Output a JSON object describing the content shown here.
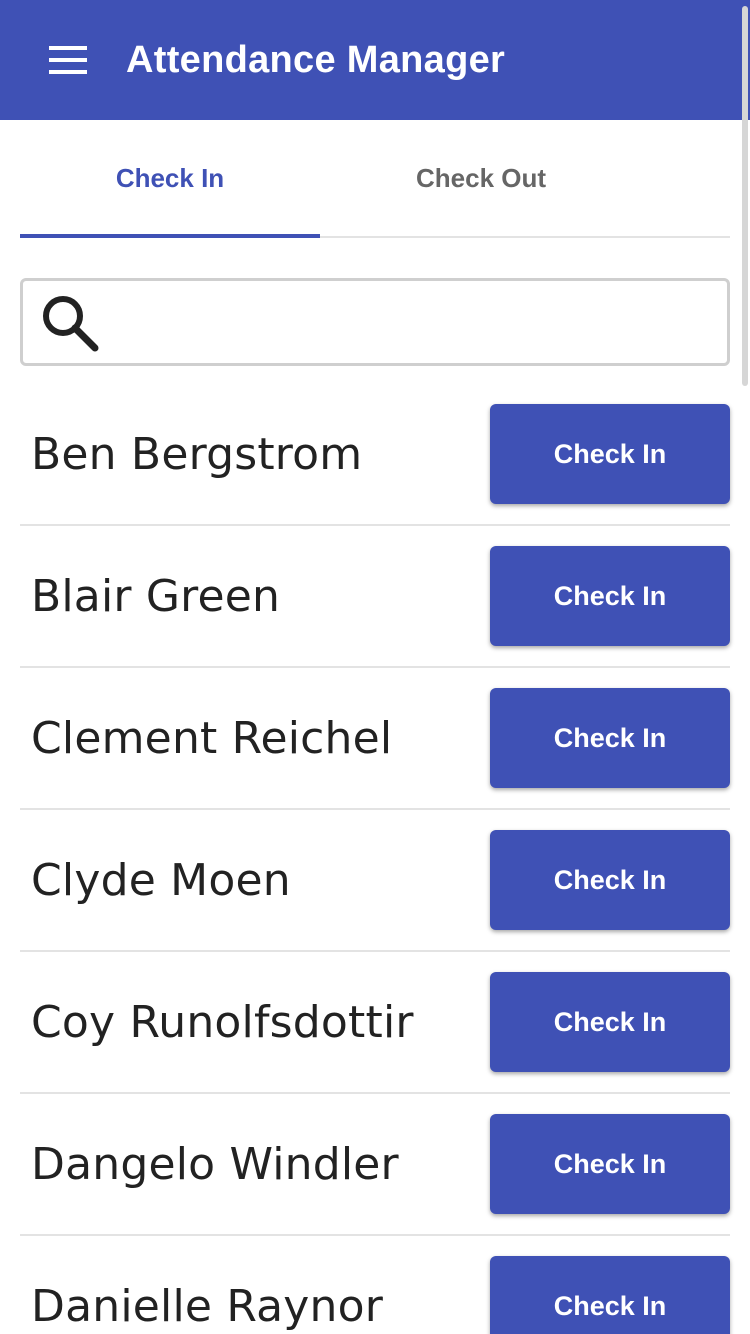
{
  "app": {
    "title": "Attendance Manager",
    "accent": "#3f51b5"
  },
  "tabs": [
    {
      "label": "Check In",
      "active": true
    },
    {
      "label": "Check Out",
      "active": false
    }
  ],
  "search": {
    "value": "",
    "placeholder": ""
  },
  "attendees": [
    {
      "name": "Ben Bergstrom",
      "action": "Check In"
    },
    {
      "name": "Blair Green",
      "action": "Check In"
    },
    {
      "name": "Clement Reichel",
      "action": "Check In"
    },
    {
      "name": "Clyde Moen",
      "action": "Check In"
    },
    {
      "name": "Coy Runolfsdottir",
      "action": "Check In"
    },
    {
      "name": "Dangelo Windler",
      "action": "Check In"
    },
    {
      "name": "Danielle Raynor",
      "action": "Check In"
    }
  ],
  "icons": {
    "menu": "hamburger-menu-icon",
    "search": "search-icon"
  }
}
